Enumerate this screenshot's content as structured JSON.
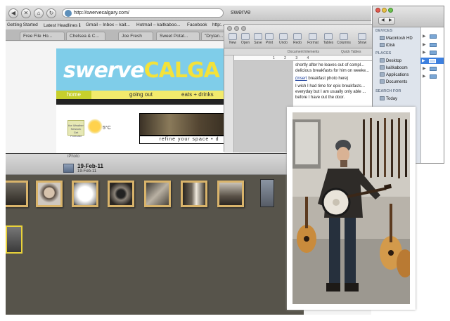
{
  "browser": {
    "window_title": "swerve",
    "url": "http://swervecalgary.com/",
    "bookmarks": [
      "Getting Started",
      "Latest Headlines ℹ",
      "Gmail – Inbox – kait...",
      "Hotmail – kaitkaboo...",
      "Facebook",
      "http:..."
    ],
    "tabs": [
      "Free File Ho...",
      "Chelsea & C...",
      "Joe Fresh",
      "Sweet Potat...",
      "\"Drylan..."
    ]
  },
  "site": {
    "logo_white": "swerve",
    "logo_yellow": "CALGA",
    "nav": [
      "home",
      "going out",
      "eats + drinks"
    ],
    "weather_badge": "the Weather Network",
    "weather_badge_sub": "Get Forecast",
    "temperature": "5°C",
    "ad_tagline": "refine your space • d"
  },
  "word": {
    "toolbar": [
      "New",
      "Open",
      "Save",
      "Print",
      "Undo",
      "Redo",
      "Format",
      "Tables",
      "Columns",
      "Show"
    ],
    "gallery_tabs": [
      "Document Elements",
      "Quick Tables"
    ],
    "ruler": "1 2 3 4",
    "paragraph_1": "shortly after he leaves out of compl... delicious breakfasts for him on weeke...",
    "insert_link": "(insert",
    "insert_rest": " breakfast photo here)",
    "paragraph_2": "I wish I had time for epic breakfasts... everyday but I am usually only able ... before I have out the door."
  },
  "finder": {
    "devices_header": "DEVICES",
    "devices": [
      "Macintosh HD",
      "iDisk"
    ],
    "places_header": "PLACES",
    "places": [
      "Desktop",
      "kaitkaboom",
      "Applications",
      "Documents"
    ],
    "search_header": "SEARCH FOR",
    "search_items": [
      "Today"
    ]
  },
  "iphoto": {
    "app_title": "iPhoto",
    "event_title": "19-Feb-11",
    "event_date": "19-Feb-11",
    "thumbnail_count": 7
  },
  "colors": {
    "site_blue": "#7fcde9",
    "site_yellow": "#f2ea6c",
    "iphoto_bg": "#57544b",
    "thumb_border": "#d9b46b"
  }
}
